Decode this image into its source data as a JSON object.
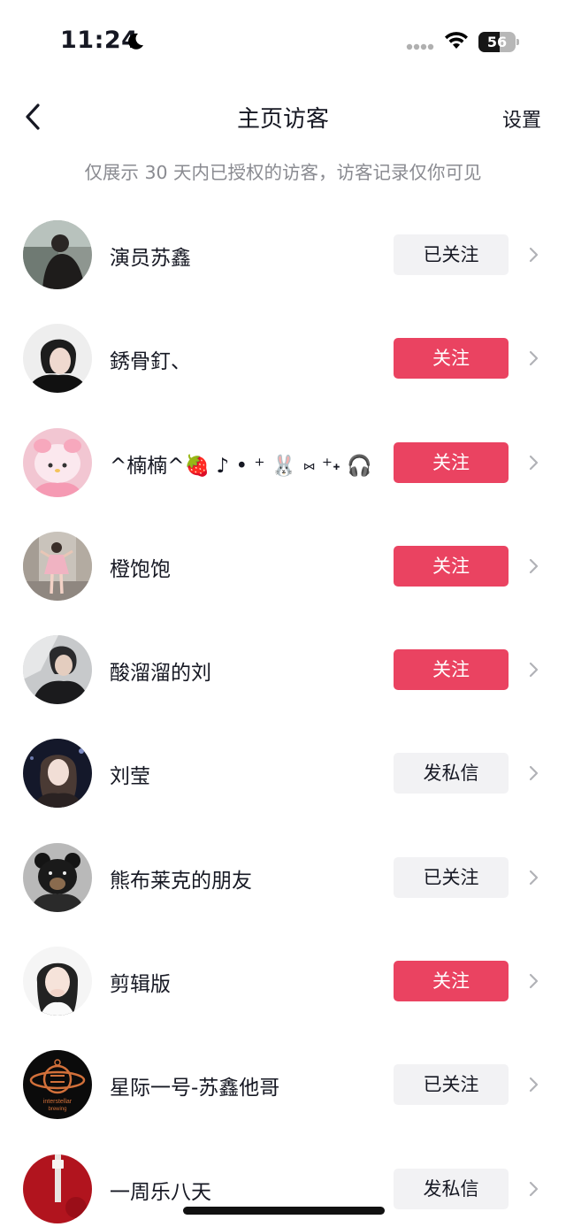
{
  "status_bar": {
    "time": "11:24",
    "battery": "56",
    "battery_level": 0.56,
    "icons": [
      "moon-icon",
      "signal-icon",
      "wifi-icon",
      "battery-icon"
    ]
  },
  "nav": {
    "title": "主页访客",
    "settings_label": "设置",
    "back_icon": "chevron-left-icon"
  },
  "subtitle": "仅展示 30 天内已授权的访客，访客记录仅你可见",
  "colors": {
    "follow_red": "#ea4361",
    "gray_button": "#f2f2f4",
    "subtitle_gray": "#8a8b91"
  },
  "visitors": [
    {
      "name": "演员苏鑫",
      "action": "已关注",
      "style": "gray"
    },
    {
      "name": "銹骨釘、",
      "action": "关注",
      "style": "red"
    },
    {
      "name": "^楠楠^🍓 ♪ • ⁺ 🐰 ⑅ ⁺˖ 🎧",
      "action": "关注",
      "style": "red"
    },
    {
      "name": "橙饱饱",
      "action": "关注",
      "style": "red"
    },
    {
      "name": "酸溜溜的刘",
      "action": "关注",
      "style": "red"
    },
    {
      "name": "刘莹",
      "action": "发私信",
      "style": "gray"
    },
    {
      "name": "熊布莱克的朋友",
      "action": "已关注",
      "style": "gray"
    },
    {
      "name": "剪辑版",
      "action": "关注",
      "style": "red"
    },
    {
      "name": "星际一号-苏鑫他哥",
      "action": "已关注",
      "style": "gray"
    },
    {
      "name": "一周乐八天",
      "action": "发私信",
      "style": "gray"
    }
  ],
  "avatar_logo_text": [
    "interstellar",
    "brewing"
  ]
}
